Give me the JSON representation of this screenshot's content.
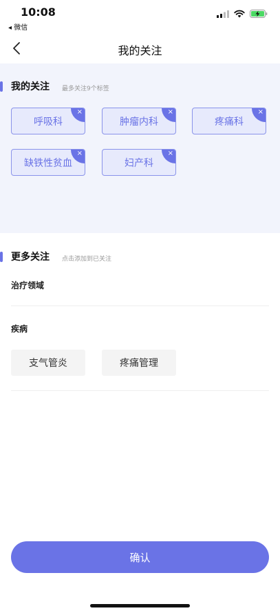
{
  "status_bar": {
    "time": "10:08",
    "back_app": "◂ 微信",
    "icons": [
      "signal-icon",
      "wifi-icon",
      "battery-charging-icon"
    ]
  },
  "nav": {
    "title": "我的关注",
    "back_icon": "chevron-left-icon"
  },
  "my_follow": {
    "title": "我的关注",
    "hint": "最多关注9个标签",
    "remove_glyph": "×",
    "tags": [
      "呼吸科",
      "肿瘤内科",
      "疼痛科",
      "缺铁性贫血",
      "妇产科"
    ]
  },
  "more_follow": {
    "title": "更多关注",
    "hint": "点击添加到已关注",
    "categories": [
      {
        "label": "治疗领域",
        "options": []
      },
      {
        "label": "疾病",
        "options": [
          "支气管炎",
          "疼痛管理"
        ]
      }
    ]
  },
  "confirm_label": "确认",
  "colors": {
    "accent": "#6a73e6",
    "tag_bg": "#e7eafc",
    "section_bg": "#f2f4fc",
    "option_bg": "#f4f4f4"
  }
}
